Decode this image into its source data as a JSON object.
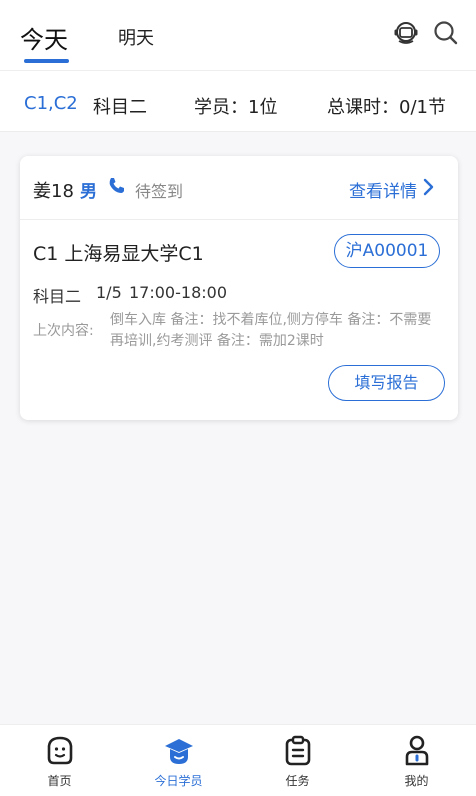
{
  "header": {
    "tabs": [
      {
        "label": "今天",
        "active": true
      },
      {
        "label": "明天",
        "active": false
      }
    ],
    "icons": [
      "support-icon",
      "search-icon"
    ]
  },
  "summary": {
    "license": "C1,C2",
    "subject": "科目二",
    "students": "学员：1位",
    "total_hours": "总课时：0/1节"
  },
  "card": {
    "student_name": "姜18",
    "gender": "男",
    "status": "待签到",
    "detail_link": "查看详情",
    "course_name": "C1 上海易显大学C1",
    "plate": "沪A00001",
    "subject": "科目二",
    "progress": "1/5",
    "time": "17:00-18:00",
    "last_label": "上次内容:",
    "last_content": "倒车入库 备注：找不着库位,侧方停车 备注：不需要再培训,约考测评 备注：需加2课时",
    "report_button": "填写报告"
  },
  "bottom_nav": [
    {
      "label": "首页",
      "icon": "home-icon",
      "active": false
    },
    {
      "label": "今日学员",
      "icon": "student-cap-icon",
      "active": true
    },
    {
      "label": "任务",
      "icon": "task-clipboard-icon",
      "active": false
    },
    {
      "label": "我的",
      "icon": "profile-icon",
      "active": false
    }
  ],
  "colors": {
    "accent": "#2b6fd6",
    "muted": "#9a9a9a",
    "background": "#f7f7f9"
  }
}
